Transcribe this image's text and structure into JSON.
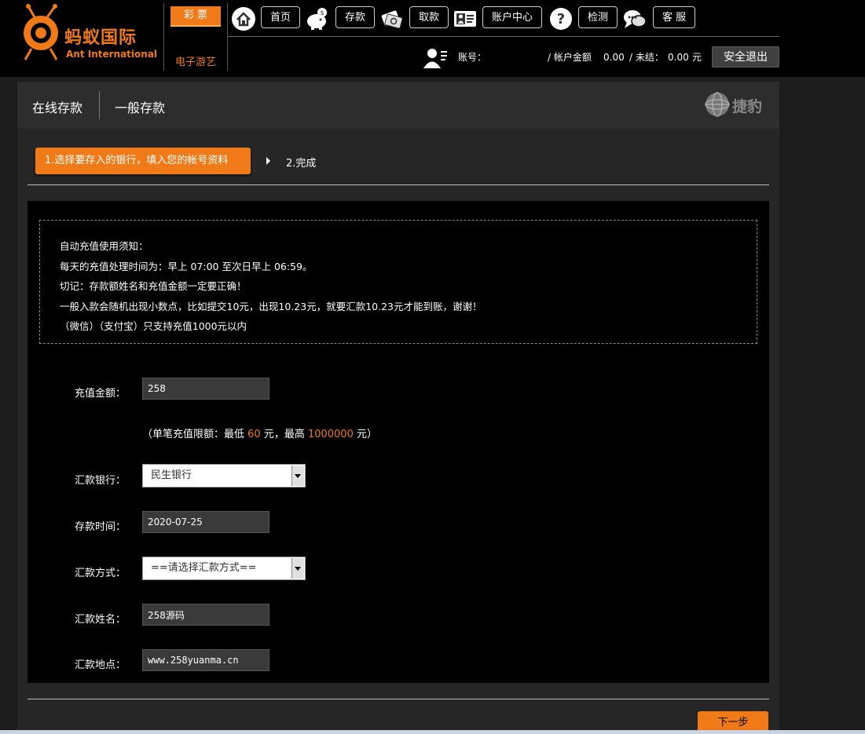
{
  "header": {
    "logo_title": "蚂蚁国际",
    "logo_sub": "Ant International",
    "game_menu": {
      "active": "彩 票",
      "link": "电子游艺"
    },
    "nav": [
      {
        "icon": "home-icon",
        "label": "首页"
      },
      {
        "icon": "piggy-bank-icon",
        "label": "存款"
      },
      {
        "icon": "cash-icon",
        "label": "取款"
      },
      {
        "icon": "id-card-icon",
        "label": "账户中心"
      },
      {
        "icon": "question-icon",
        "label": "检测"
      },
      {
        "icon": "chat-icon",
        "label": "客 服"
      }
    ],
    "user": {
      "account_label": "账号：",
      "balance_label": "/ 帐户金额",
      "balance": "0.00",
      "unsettled_label": "/ 未结：",
      "unsettled": "0.00",
      "currency": "元",
      "logout": "安全退出"
    }
  },
  "tabs": {
    "online": "在线存款",
    "normal": "一般存款",
    "brand": "捷豹"
  },
  "steps": {
    "step1": "1.选择要存入的银行，填入您的帐号资料",
    "step2": "2.完成"
  },
  "notice": {
    "lines": [
      "自动充值使用须知：",
      "每天的充值处理时间为：早上 07:00 至次日早上 06:59。",
      "切记：存款额姓名和充值金额一定要正确！",
      "一般入款会随机出现小数点，比如提交10元，出现10.23元，就要汇款10.23元才能到账，谢谢！",
      "（微信）（支付宝）只支持充值1000元以内"
    ]
  },
  "form": {
    "amount": {
      "label": "充值金额：",
      "value": "258"
    },
    "limit": {
      "prefix": "（单笔充值限额：最低",
      "min": "60",
      "mid": "元，最高",
      "max": "1000000",
      "suffix": "元）"
    },
    "bank": {
      "label": "汇款银行：",
      "value": "民生银行"
    },
    "time": {
      "label": "存款时间：",
      "value": "2020-07-25"
    },
    "method": {
      "label": "汇款方式：",
      "value": "==请选择汇款方式=="
    },
    "name": {
      "label": "汇款姓名：",
      "value": "258源码"
    },
    "place": {
      "label": "汇款地点：",
      "value": "www.258yuanma.cn"
    }
  },
  "next_button": "下一步",
  "colors": {
    "accent": "#f07a17",
    "header_bg": "#000000",
    "panel_bg": "#262626"
  }
}
